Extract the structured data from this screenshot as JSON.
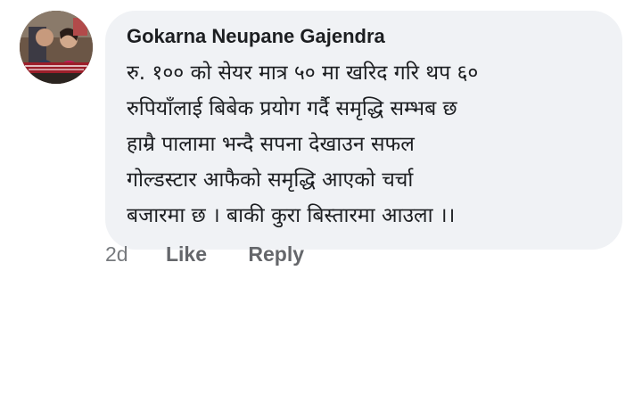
{
  "comment": {
    "author": "Gokarna Neupane Gajendra",
    "lines": [
      "रु. १०० को सेयर मात्र ५० मा खरिद गरि थप ६०",
      "रुपियाँलाई  बिबेक प्रयोग गर्दै समृद्धि सम्भब छ",
      "हाम्रै पालामा भन्दै सपना देखाउन सफल",
      "गोल्डस्टार आफैको समृद्धि आएको चर्चा",
      "बजारमा छ । बाकी कुरा बिस्तारमा आउला ।।"
    ],
    "timestamp": "2d",
    "like_label": "Like",
    "reply_label": "Reply"
  },
  "colors": {
    "bubble_bg": "#f0f2f5",
    "text": "#1c1e21",
    "action_text": "#65676b"
  }
}
